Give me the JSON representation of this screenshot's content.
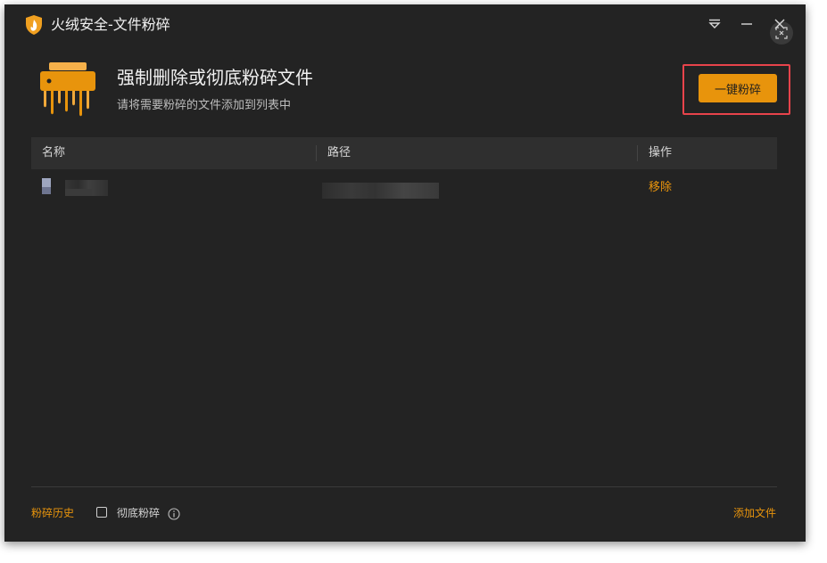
{
  "window": {
    "title": "火绒安全-文件粉碎",
    "controls": [
      "menu-icon",
      "minimize-icon",
      "close-icon"
    ]
  },
  "hero": {
    "icon": "shredder-icon",
    "title": "强制删除或彻底粉碎文件",
    "subtitle": "请将需要粉碎的文件添加到列表中"
  },
  "actions": {
    "shred_label": "一键粉碎"
  },
  "table": {
    "columns": [
      "名称",
      "路径",
      "操作"
    ],
    "rows": [
      {
        "name": "",
        "path": "",
        "action": "移除"
      }
    ]
  },
  "footer": {
    "history_label": "粉碎历史",
    "thorough_label": "彻底粉碎",
    "thorough_checked": false,
    "add_file_label": "添加文件"
  },
  "colors": {
    "accent": "#e8940c",
    "background": "#232323",
    "highlight": "#e8434b"
  }
}
